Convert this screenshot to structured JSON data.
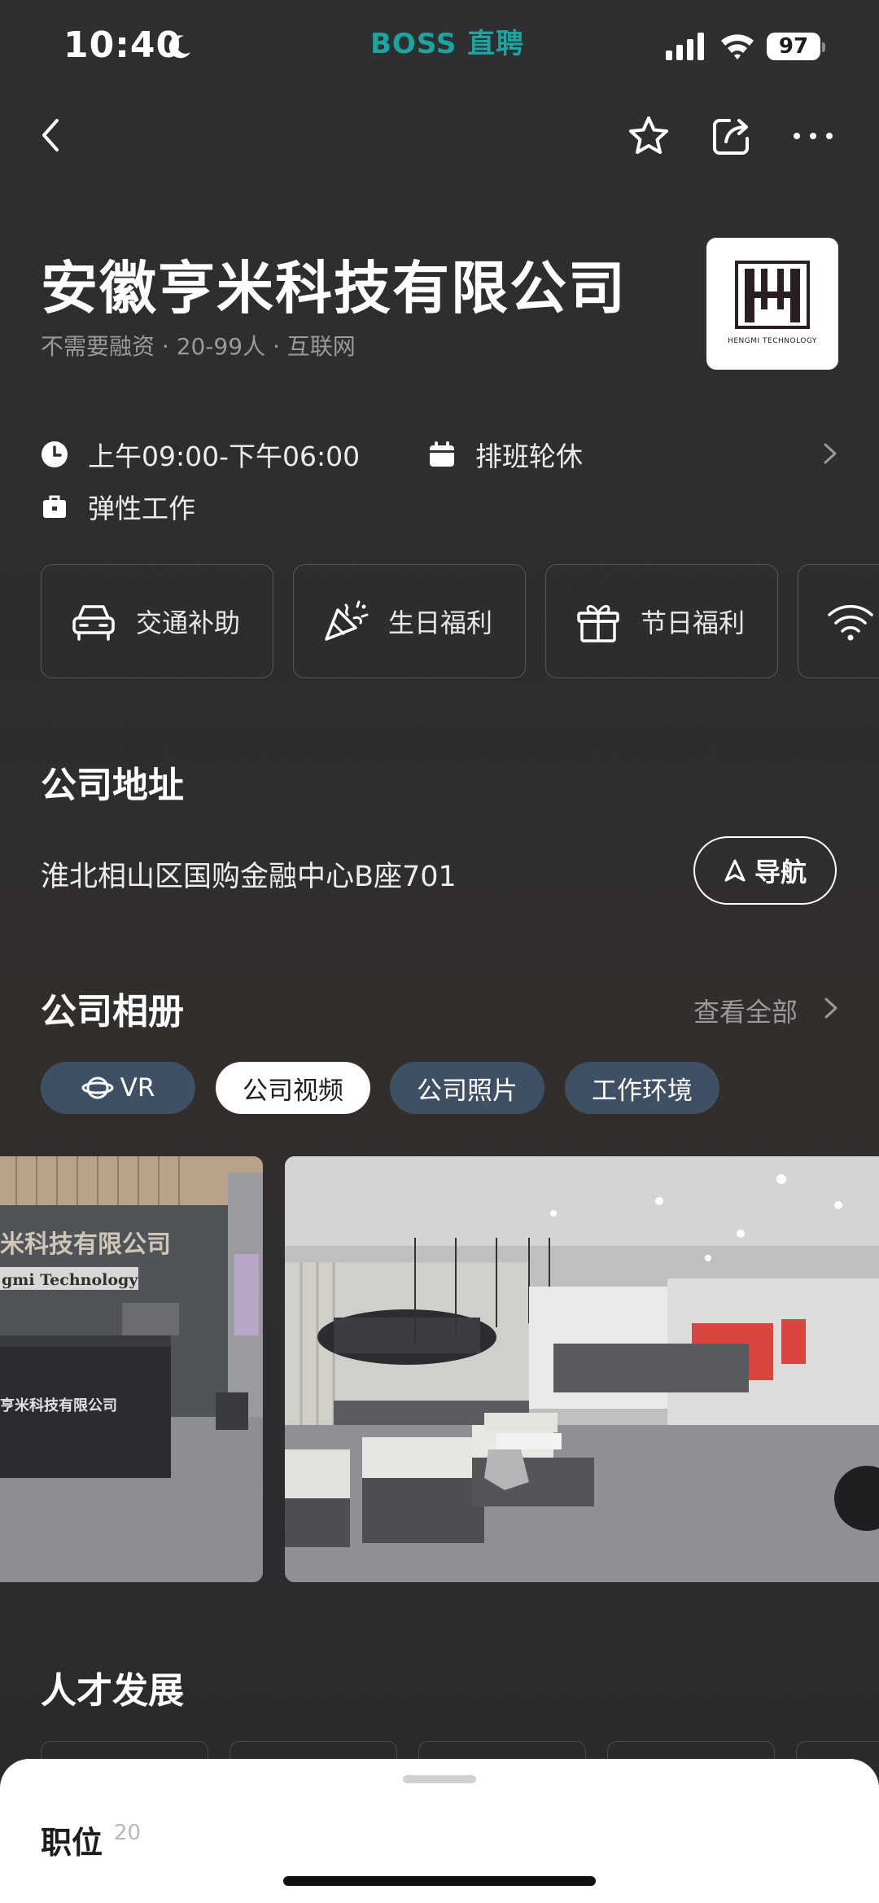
{
  "status_bar": {
    "time": "10:40",
    "battery": "97",
    "brand": "BOSS 直聘"
  },
  "company": {
    "name": "安徽亨米科技有限公司",
    "meta": "不需要融资 · 20-99人 · 互联网",
    "logo_text": "HENGMI TECHNOLOGY"
  },
  "work_info": {
    "hours": "上午09:00-下午06:00",
    "schedule": "排班轮休",
    "flex": "弹性工作"
  },
  "benefits": [
    {
      "label": "交通补助",
      "icon": "car-icon"
    },
    {
      "label": "生日福利",
      "icon": "party-icon"
    },
    {
      "label": "节日福利",
      "icon": "gift-icon"
    },
    {
      "label": "",
      "icon": "wifi-icon"
    }
  ],
  "address_section": {
    "title": "公司地址",
    "address": "淮北相山区国购金融中心B座701",
    "nav_label": "导航"
  },
  "album_section": {
    "title": "公司相册",
    "view_all": "查看全部",
    "tabs": [
      "VR",
      "公司视频",
      "公司照片",
      "工作环境"
    ],
    "active_tab": "公司视频",
    "photo1_sign": "米科技有限公司",
    "photo1_sign2": "gmi Technology",
    "photo1_desk": "亨米科技有限公司"
  },
  "talent_section": {
    "title": "人才发展"
  },
  "bottom_sheet": {
    "title": "职位",
    "count": "20"
  },
  "colors": {
    "brand": "#19a5a0",
    "pill_bg": "#3f5065",
    "accent_white": "#ffffff"
  }
}
